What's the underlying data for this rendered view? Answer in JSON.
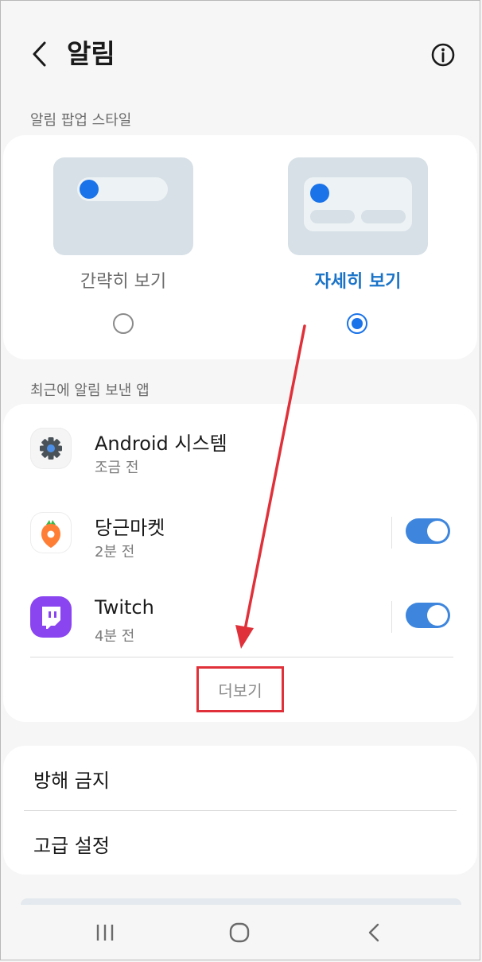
{
  "header": {
    "title": "알림",
    "back_icon": "chevron-left-icon",
    "info_icon": "info-circle-icon"
  },
  "popup_style": {
    "section_label": "알림 팝업 스타일",
    "options": [
      {
        "label": "간략히 보기",
        "selected": false
      },
      {
        "label": "자세히 보기",
        "selected": true
      }
    ]
  },
  "recent_apps": {
    "section_label": "최근에 알림 보낸 앱",
    "apps": [
      {
        "name": "Android 시스템",
        "time": "조금 전",
        "icon": "gear-icon",
        "toggle": null
      },
      {
        "name": "당근마켓",
        "time": "2분 전",
        "icon": "carrot-icon",
        "toggle": true
      },
      {
        "name": "Twitch",
        "time": "4분 전",
        "icon": "twitch-icon",
        "toggle": true
      }
    ],
    "more_label": "더보기"
  },
  "menu": {
    "dnd_label": "방해 금지",
    "advanced_label": "고급 설정"
  },
  "navbar": {
    "recents_icon": "recents-icon",
    "home_icon": "home-icon",
    "back_icon": "back-icon"
  },
  "colors": {
    "accent": "#1a73c8",
    "toggle_on": "#3e86dd",
    "preview_bg": "#d6e0e6",
    "annotation_red": "#e0313a",
    "page_bg": "#f6f6f6"
  }
}
